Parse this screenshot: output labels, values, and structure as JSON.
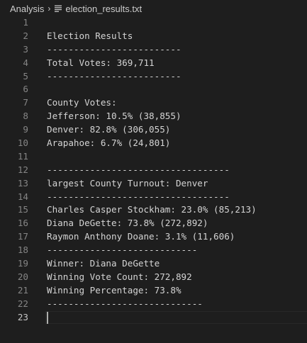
{
  "breadcrumb": {
    "folder": "Analysis",
    "separator": "›",
    "file_icon": "file-lines-icon",
    "file": "election_results.txt"
  },
  "editor": {
    "current_line": 23,
    "lines": [
      {
        "num": "1",
        "text": ""
      },
      {
        "num": "2",
        "text": "Election Results"
      },
      {
        "num": "3",
        "text": "-------------------------"
      },
      {
        "num": "4",
        "text": "Total Votes: 369,711"
      },
      {
        "num": "5",
        "text": "-------------------------"
      },
      {
        "num": "6",
        "text": ""
      },
      {
        "num": "7",
        "text": "County Votes:"
      },
      {
        "num": "8",
        "text": "Jefferson: 10.5% (38,855)"
      },
      {
        "num": "9",
        "text": "Denver: 82.8% (306,055)"
      },
      {
        "num": "10",
        "text": "Arapahoe: 6.7% (24,801)"
      },
      {
        "num": "11",
        "text": ""
      },
      {
        "num": "12",
        "text": "----------------------------------"
      },
      {
        "num": "13",
        "text": "largest County Turnout: Denver"
      },
      {
        "num": "14",
        "text": "----------------------------------"
      },
      {
        "num": "15",
        "text": "Charles Casper Stockham: 23.0% (85,213)"
      },
      {
        "num": "16",
        "text": "Diana DeGette: 73.8% (272,892)"
      },
      {
        "num": "17",
        "text": "Raymon Anthony Doane: 3.1% (11,606)"
      },
      {
        "num": "18",
        "text": "----------------------------"
      },
      {
        "num": "19",
        "text": "Winner: Diana DeGette"
      },
      {
        "num": "20",
        "text": "Winning Vote Count: 272,892"
      },
      {
        "num": "21",
        "text": "Winning Percentage: 73.8%"
      },
      {
        "num": "22",
        "text": "-----------------------------"
      },
      {
        "num": "23",
        "text": ""
      }
    ]
  },
  "colors": {
    "background": "#1e1e1e",
    "text": "#d4d4d4",
    "line_number": "#858585",
    "active_line_number": "#c6c6c6"
  }
}
